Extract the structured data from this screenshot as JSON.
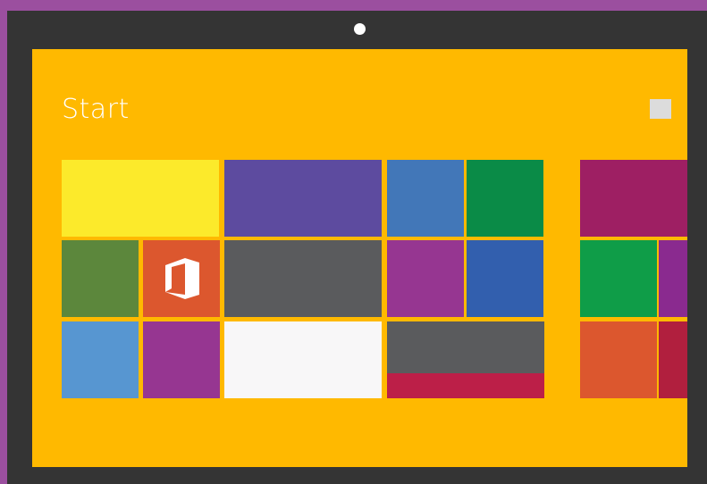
{
  "start_screen": {
    "title": "Start"
  },
  "tiles": [
    {
      "name": "tile-yellow-wide",
      "color": "#fcea2b"
    },
    {
      "name": "tile-purple-wide",
      "color": "#5d4b9f"
    },
    {
      "name": "tile-blue",
      "color": "#4277b8"
    },
    {
      "name": "tile-green",
      "color": "#0a8b47"
    },
    {
      "name": "tile-olive-green",
      "color": "#5c873c"
    },
    {
      "name": "tile-office",
      "color": "#dc572e",
      "icon": "office-icon"
    },
    {
      "name": "tile-dark-gray-wide",
      "color": "#5a5b5d"
    },
    {
      "name": "tile-magenta",
      "color": "#963691"
    },
    {
      "name": "tile-royal-blue",
      "color": "#325fae"
    },
    {
      "name": "tile-light-blue",
      "color": "#5796d1"
    },
    {
      "name": "tile-purple",
      "color": "#963691"
    },
    {
      "name": "tile-white-wide",
      "color": "#f8f7f8"
    },
    {
      "name": "tile-gray-wide",
      "color": "#5a5b5d"
    },
    {
      "name": "tile-crimson-strip",
      "color": "#bc1f48"
    },
    {
      "name": "tile-maroon-wide",
      "color": "#9e1f63"
    },
    {
      "name": "tile-green-2",
      "color": "#0f9d48"
    },
    {
      "name": "tile-purple-2",
      "color": "#8a2a8f"
    },
    {
      "name": "tile-orange",
      "color": "#dc572e"
    },
    {
      "name": "tile-crimson-2",
      "color": "#b11f3e"
    }
  ]
}
